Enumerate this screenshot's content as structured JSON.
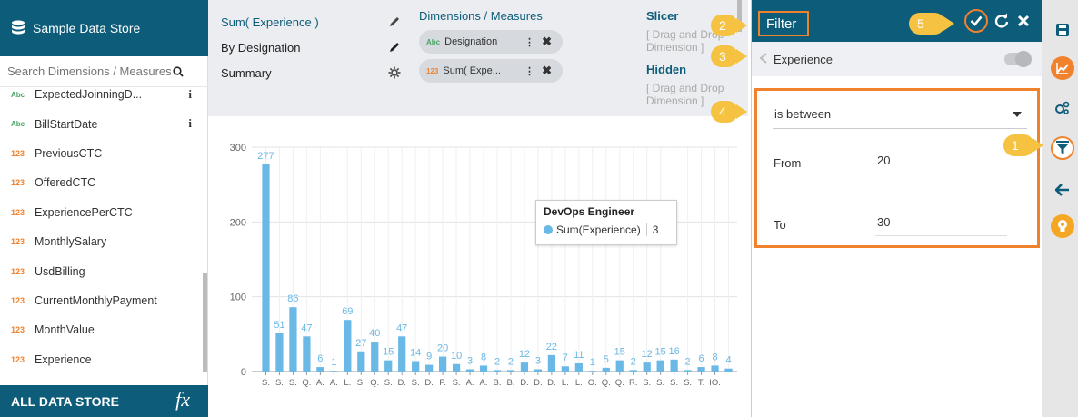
{
  "datastore": {
    "title": "Sample Data Store",
    "search_placeholder": "Search Dimensions / Measures",
    "fields": [
      {
        "type": "Abc",
        "name": "ExpectedJoinningD...",
        "info": "i"
      },
      {
        "type": "Abc",
        "name": "BillStartDate",
        "info": "i"
      },
      {
        "type": "123",
        "name": "PreviousCTC"
      },
      {
        "type": "123",
        "name": "OfferedCTC"
      },
      {
        "type": "123",
        "name": "ExperiencePerCTC"
      },
      {
        "type": "123",
        "name": "MonthlySalary"
      },
      {
        "type": "123",
        "name": "UsdBilling"
      },
      {
        "type": "123",
        "name": "CurrentMonthlyPayment"
      },
      {
        "type": "123",
        "name": "MonthValue"
      },
      {
        "type": "123",
        "name": "Experience"
      }
    ],
    "footer_label": "ALL DATA STORE",
    "fx_label": "fx"
  },
  "properties": {
    "items": [
      "Sum( Experience )",
      "By Designation",
      "Summary"
    ],
    "dims_title": "Dimensions / Measures",
    "dims": [
      {
        "type": "Abc",
        "label": "Designation",
        "menu": "⋮",
        "remove": "✖"
      },
      {
        "type": "123",
        "label": "Sum( Expe...",
        "menu": "⋮",
        "remove": "✖"
      }
    ],
    "slicer_title": "Slicer",
    "slicer_placeholder": "[ Drag and Drop Dimension ]",
    "hidden_title": "Hidden",
    "hidden_placeholder": "[ Drag and Drop Dimension ]"
  },
  "tooltip": {
    "title": "DevOps Engineer",
    "series": "Sum(Experience)",
    "value": "3"
  },
  "filter": {
    "title": "Filter",
    "field": "Experience",
    "condition": "is between",
    "from_label": "From",
    "from_value": "20",
    "to_label": "To",
    "to_value": "30"
  },
  "badges": [
    "1",
    "2",
    "3",
    "4",
    "5"
  ],
  "colors": {
    "brand": "#0d5c7a",
    "accent": "#f0822e",
    "bar": "#6ab8e6",
    "badge": "#f5c242"
  },
  "icons": {
    "rail": [
      "save-icon",
      "chart-icon",
      "settings-icon",
      "filter-icon",
      "back-arrow-icon",
      "bulb-icon"
    ]
  },
  "chart_data": {
    "type": "bar",
    "categories": [
      "S.",
      "S.",
      "S.",
      "Q.",
      "A.",
      "A.",
      "L.",
      "S.",
      "Q.",
      "S.",
      "D.",
      "S.",
      "D.",
      "P.",
      "S.",
      "A.",
      "A.",
      "B.",
      "B.",
      "D.",
      "D.",
      "D.",
      "L.",
      "L.",
      "O.",
      "Q.",
      "Q.",
      "R.",
      "S.",
      "S.",
      "S.",
      "S.",
      "T.",
      "IO."
    ],
    "values": [
      277,
      51,
      86,
      47,
      6,
      1,
      69,
      27,
      40,
      15,
      47,
      14,
      9,
      20,
      10,
      3,
      8,
      2,
      2,
      12,
      3,
      22,
      7,
      11,
      1,
      5,
      15,
      2,
      12,
      15,
      16,
      2,
      6,
      8,
      4
    ],
    "ylim": [
      0,
      300
    ],
    "yticks": [
      0,
      100,
      200,
      300
    ],
    "grid": true,
    "series": [
      {
        "name": "Sum(Experience)"
      }
    ]
  }
}
